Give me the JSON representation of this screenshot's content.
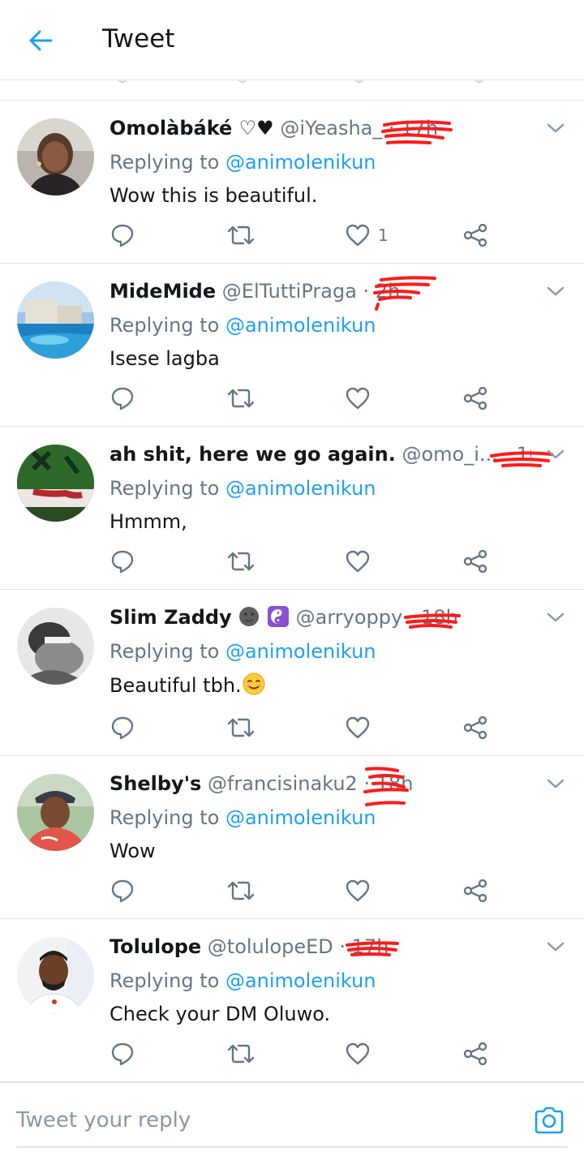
{
  "header": {
    "title": "Tweet"
  },
  "colors": {
    "accent": "#1da1f2",
    "secondary_text": "#657786",
    "redaction": "#ff1a1a"
  },
  "tweets": [
    {
      "name": "Omolàbáké ♡♥",
      "handle": "@iYeasha_",
      "time": "· 17h",
      "replying_prefix": "Replying to",
      "replying_to": "@animolenikun",
      "text": "Wow this is beautiful.",
      "like_count": "1"
    },
    {
      "name": "MideMide",
      "handle": "@ElTuttiPraga",
      "time": "· 2h",
      "replying_prefix": "Replying to",
      "replying_to": "@animolenikun",
      "text": "Isese lagba",
      "like_count": ""
    },
    {
      "name": "ah shit, here we go again.",
      "handle": "@omo_i...",
      "time": "· 16h",
      "replying_prefix": "Replying to",
      "replying_to": "@animolenikun",
      "text": "Hmmm,",
      "like_count": ""
    },
    {
      "name": "Slim Zaddy",
      "handle": "@arryoppy",
      "time": "· 18h",
      "replying_prefix": "Replying to",
      "replying_to": "@animolenikun",
      "text": "Beautiful tbh.",
      "like_count": ""
    },
    {
      "name": "Shelby's",
      "handle": "@francisinaku2",
      "time": "· 18h",
      "replying_prefix": "Replying to",
      "replying_to": "@animolenikun",
      "text": "Wow",
      "like_count": ""
    },
    {
      "name": "Tolulope",
      "handle": "@tolulopeED",
      "time": "· 17h",
      "replying_prefix": "Replying to",
      "replying_to": "@animolenikun",
      "text": "Check your DM Oluwo.",
      "like_count": ""
    }
  ],
  "reply_bar": {
    "placeholder": "Tweet your reply"
  },
  "icons": {
    "back": "arrow-left-icon",
    "more": "chevron-down-icon",
    "reply": "speech-bubble-icon",
    "retweet": "retweet-icon",
    "like": "heart-icon",
    "share": "share-icon",
    "camera": "camera-icon"
  }
}
